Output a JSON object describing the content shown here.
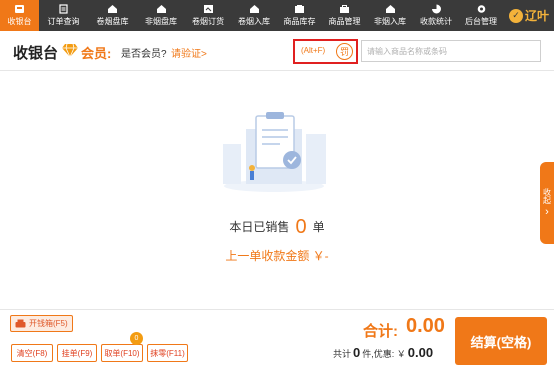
{
  "nav": {
    "items": [
      {
        "label": "收银台",
        "icon": "cashier-icon",
        "active": true
      },
      {
        "label": "订单查询",
        "icon": "order-icon"
      },
      {
        "label": "卷烟盘库",
        "icon": "cigarette-stock-icon"
      },
      {
        "label": "非烟盘库",
        "icon": "non-cigarette-stock-icon"
      },
      {
        "label": "卷烟订货",
        "icon": "cigarette-order-icon"
      },
      {
        "label": "卷烟入库",
        "icon": "cigarette-inbound-icon"
      },
      {
        "label": "商品库存",
        "icon": "goods-stock-icon"
      },
      {
        "label": "商品管理",
        "icon": "goods-manage-icon"
      },
      {
        "label": "非烟入库",
        "icon": "non-cigarette-inbound-icon"
      },
      {
        "label": "收款统计",
        "icon": "payment-stats-icon"
      },
      {
        "label": "后台管理",
        "icon": "admin-icon"
      }
    ],
    "logo_text": "辽叶",
    "active_color": "#f07818"
  },
  "header": {
    "title": "收银台",
    "member_label": "会员:",
    "member_question": "是否会员?",
    "verify_link": "请验证>",
    "shortcut": "(Alt+F)",
    "fine_label": "罚",
    "search_placeholder": "请输入商品名称或条码"
  },
  "main": {
    "sold_prefix": "本日已销售",
    "sold_count": "0",
    "sold_unit": "单",
    "last_amount": "上一单收款金额 ￥-"
  },
  "side_tab": {
    "label": "收起",
    "arrow": "›"
  },
  "bottom": {
    "cashbox": "开钱箱(F5)",
    "buttons": [
      "清空(F8)",
      "挂单(F9)",
      "取单(F10)",
      "抹零(F11)"
    ],
    "badge_count": "0",
    "total_label": "合计:",
    "total_value": "0.00",
    "summary_prefix": "共计",
    "summary_count": "0",
    "summary_mid": "件,",
    "discount_label": "优惠: ￥",
    "discount_value": "0.00",
    "checkout": "结算(空格)"
  }
}
